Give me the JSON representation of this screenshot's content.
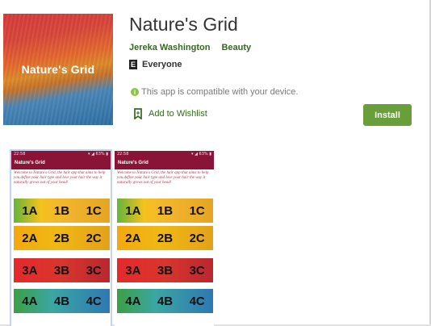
{
  "app": {
    "title": "Nature's Grid",
    "icon_text": "Nature's Grid",
    "developer": "Jereka Washington",
    "category": "Beauty",
    "content_rating_badge": "E",
    "content_rating": "Everyone",
    "compatibility": "This app is compatible with your device.",
    "wishlist_label": "Add to Wishlist",
    "install_label": "Install"
  },
  "screenshots": [
    {
      "status_left": "22:58",
      "status_right": "▾ ◢ 63% ▮",
      "toolbar_title": "Nature's Grid",
      "intro": "Welcome to Nature's Grid, the hair app that aims to help you define your hair type and love your hair the way it naturally grows out of your head!",
      "rows": [
        [
          "1A",
          "1B",
          "1C"
        ],
        [
          "2A",
          "2B",
          "2C"
        ],
        [
          "3A",
          "3B",
          "3C"
        ],
        [
          "4A",
          "4B",
          "4C"
        ]
      ]
    },
    {
      "status_left": "22:58",
      "status_right": "▾ ◢ 63% ▮",
      "toolbar_title": "Nature's Grid",
      "intro": "Welcome to Nature's Grid, the hair app that aims to help you define your hair type and love your hair the way it naturally grows out of your head!",
      "rows": [
        [
          "1A",
          "1B",
          "1C"
        ],
        [
          "2A",
          "2B",
          "2C"
        ],
        [
          "3A",
          "3B",
          "3C"
        ],
        [
          "4A",
          "4B",
          "4C"
        ]
      ]
    }
  ],
  "colors": {
    "install_button": "#689f38",
    "developer_text": "#33691e",
    "toolbar": "#8a1338"
  },
  "icons": [
    "esrb-everyone-icon",
    "info-icon",
    "bookmark-icon"
  ]
}
